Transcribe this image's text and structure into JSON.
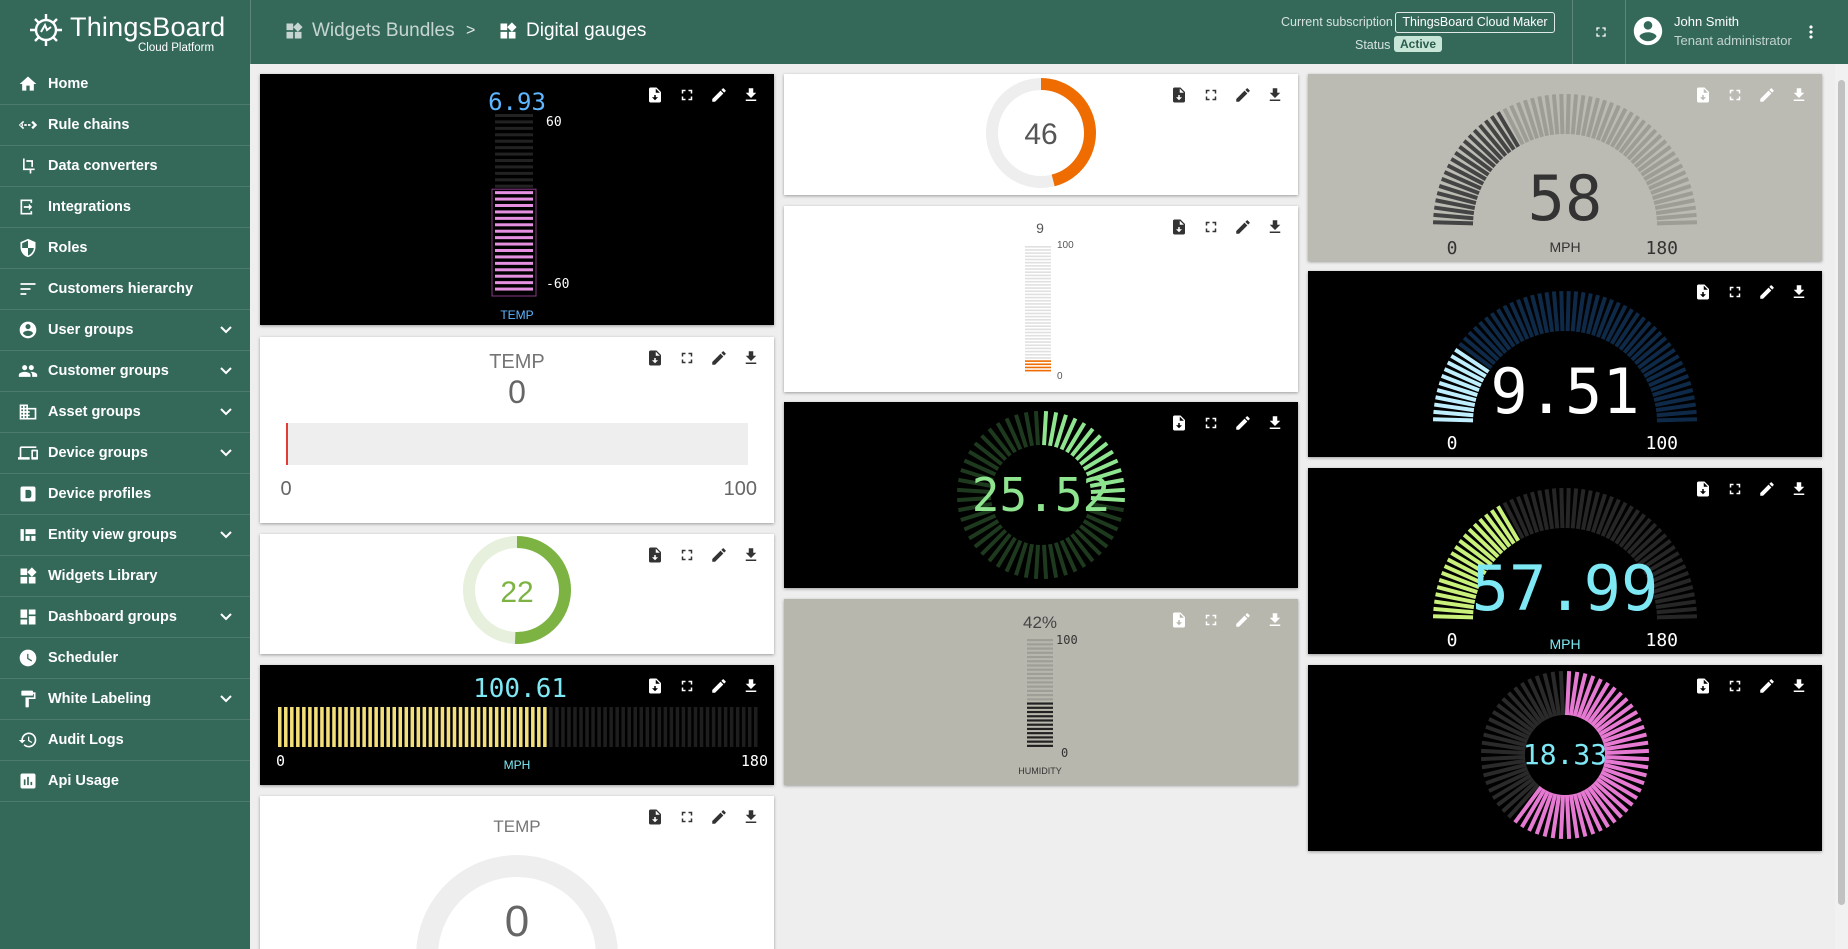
{
  "header": {
    "brand": "ThingsBoard",
    "brand_sub": "Cloud Platform",
    "breadcrumb": [
      {
        "label": "Widgets Bundles"
      },
      {
        "label": "Digital gauges"
      }
    ],
    "separator": ">",
    "subscription_label": "Current subscription",
    "subscription_value": "ThingsBoard Cloud Maker",
    "status_label": "Status",
    "status_value": "Active",
    "user_name": "John Smith",
    "user_role": "Tenant administrator"
  },
  "sidebar": {
    "items": [
      {
        "label": "Home",
        "icon": "home-icon",
        "expandable": false
      },
      {
        "label": "Rule chains",
        "icon": "rule-chains-icon",
        "expandable": false
      },
      {
        "label": "Data converters",
        "icon": "data-converters-icon",
        "expandable": false
      },
      {
        "label": "Integrations",
        "icon": "integrations-icon",
        "expandable": false
      },
      {
        "label": "Roles",
        "icon": "roles-icon",
        "expandable": false
      },
      {
        "label": "Customers hierarchy",
        "icon": "customers-hierarchy-icon",
        "expandable": false
      },
      {
        "label": "User groups",
        "icon": "user-groups-icon",
        "expandable": true
      },
      {
        "label": "Customer groups",
        "icon": "customer-groups-icon",
        "expandable": true
      },
      {
        "label": "Asset groups",
        "icon": "asset-groups-icon",
        "expandable": true
      },
      {
        "label": "Device groups",
        "icon": "device-groups-icon",
        "expandable": true
      },
      {
        "label": "Device profiles",
        "icon": "device-profiles-icon",
        "expandable": false
      },
      {
        "label": "Entity view groups",
        "icon": "entity-view-groups-icon",
        "expandable": true
      },
      {
        "label": "Widgets Library",
        "icon": "widgets-library-icon",
        "expandable": false
      },
      {
        "label": "Dashboard groups",
        "icon": "dashboard-groups-icon",
        "expandable": true
      },
      {
        "label": "Scheduler",
        "icon": "scheduler-icon",
        "expandable": false
      },
      {
        "label": "White Labeling",
        "icon": "white-labeling-icon",
        "expandable": true
      },
      {
        "label": "Audit Logs",
        "icon": "audit-logs-icon",
        "expandable": false
      },
      {
        "label": "Api Usage",
        "icon": "api-usage-icon",
        "expandable": false
      }
    ]
  },
  "widgets": {
    "w1": {
      "value": "6.93",
      "max": "60",
      "min": "-60",
      "label": "TEMP",
      "level": 0.56
    },
    "w2": {
      "title": "TEMP",
      "value": "0",
      "min": "0",
      "max": "100",
      "level": 0
    },
    "w3": {
      "value": "22",
      "level": 0.22,
      "color": "#7cb342"
    },
    "w4": {
      "value": "100.61",
      "min": "0",
      "max": "180",
      "label": "MPH",
      "level": 0.56
    },
    "w5": {
      "title": "TEMP",
      "value": "0"
    },
    "w6": {
      "value": "46",
      "level": 0.46,
      "color": "#ef6c00"
    },
    "w7": {
      "value": "9",
      "max": "100",
      "min": "0",
      "level": 0.09,
      "color": "#ef6c00"
    },
    "w8": {
      "value": "25.52",
      "level": 0.2552,
      "color": "#8fe58f"
    },
    "w9": {
      "value": "42%",
      "max": "100",
      "min": "0",
      "label": "HUMIDITY",
      "level": 0.42
    },
    "w10": {
      "value": "58",
      "min": "0",
      "max": "180",
      "label": "MPH",
      "level": 0.322
    },
    "w11": {
      "value": "9.51",
      "min": "0",
      "max": "100",
      "level": 0.0951
    },
    "w12": {
      "value": "57.99",
      "min": "0",
      "max": "180",
      "label": "MPH",
      "level": 0.322
    },
    "w13": {
      "value": "18.33",
      "level": 0.6,
      "color": "#e67ad2"
    }
  },
  "colors": {
    "header": "#34695a",
    "accent_orange": "#ef6c00",
    "accent_green": "#7cb342",
    "cyan": "#7ee8f5"
  }
}
